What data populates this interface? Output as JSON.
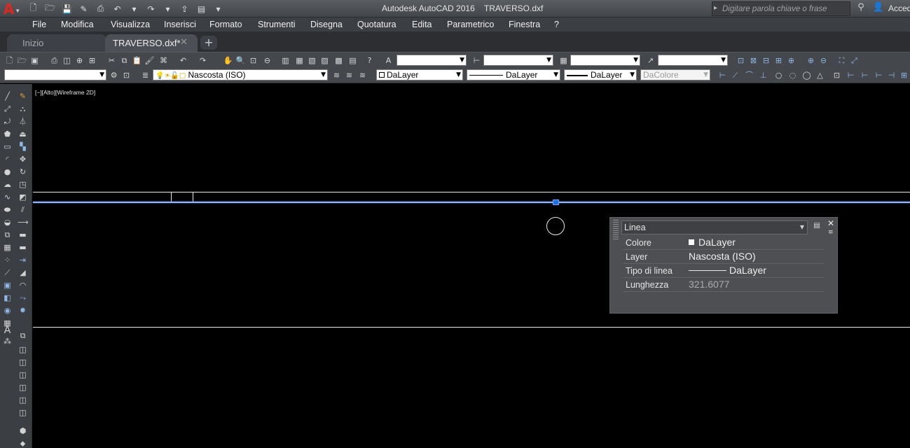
{
  "titlebar": {
    "title": "Autodesk AutoCAD 2016    TRAVERSO.dxf",
    "app_icon": "A",
    "search_placeholder": "Digitare parola chiave o frase",
    "sign_in": "Accedi"
  },
  "menu": [
    "File",
    "Modifica",
    "Visualizza",
    "Inserisci",
    "Formato",
    "Strumenti",
    "Disegna",
    "Quotatura",
    "Edita",
    "Parametrico",
    "Finestra",
    "?"
  ],
  "tabs": {
    "start": "Inizio",
    "active": "TRAVERSO.dxf*",
    "close": "✕",
    "new": "+"
  },
  "properties_toolbar": {
    "layer": "Nascosta (ISO)",
    "color": "DaLayer",
    "linetype": "DaLayer",
    "lineweight": "DaLayer",
    "plotstyle": "DaColore"
  },
  "viewport_controls": "[−][Alto][Wireframe 2D]",
  "quick_properties": {
    "object_type": "Linea",
    "rows": [
      {
        "label": "Colore",
        "value": "DaLayer"
      },
      {
        "label": "Layer",
        "value": "Nascosta (ISO)"
      },
      {
        "label": "Tipo di linea",
        "value": "DaLayer"
      },
      {
        "label": "Lunghezza",
        "value": "321.6077"
      }
    ]
  },
  "colors": {
    "accent_red": "#e0271f",
    "selection_blue": "#1f6fe0",
    "canvas": "#000000"
  }
}
